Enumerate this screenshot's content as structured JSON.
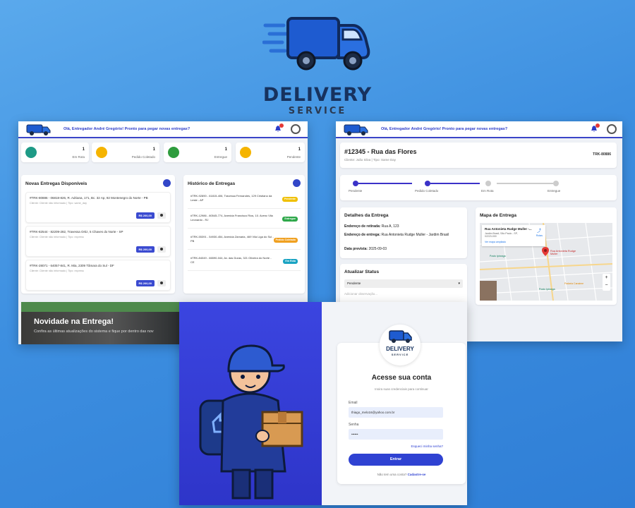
{
  "brand": {
    "title": "DELIVERY",
    "subtitle": "SERVICE"
  },
  "dashboard": {
    "greeting": "Olá, Entregador André Gregório! Pronto para pegar novas entregas?",
    "stats": [
      {
        "icon": "route-icon",
        "value": "1",
        "label": "Em Rota",
        "color": "#1e9a86"
      },
      {
        "icon": "clock-icon",
        "value": "1",
        "label": "Pedido Coletado",
        "color": "#f5b400"
      },
      {
        "icon": "thumbs-up-icon",
        "value": "1",
        "label": "Entregue",
        "color": "#2e9c3e"
      },
      {
        "icon": "clock-icon",
        "value": "1",
        "label": "Pendente",
        "color": "#f5b400"
      }
    ],
    "new_title": "Novas Entregas Disponíveis",
    "new_deliveries": [
      {
        "title": "#TRK-80886 - 06818-826, R. Adriana, 171, Bc. 32 Ap, 92 Montenegro do Norte - PB",
        "meta": "Cliente: Cliente não informado | Tipo: same_day",
        "price": "R$ 200,00"
      },
      {
        "title": "#TRK-82544 - 82209-282, Travessa Ortiz, 5 Chaves do Norte - SP",
        "meta": "Cliente: Cliente não informado | Tipo: express",
        "price": "R$ 200,00"
      },
      {
        "title": "#TRK-28071 - 64057-841, R. Mia, 2309 Tâmara do Sul - DF",
        "meta": "Cliente: Cliente não informado | Tipo: express",
        "price": "R$ 200,00"
      }
    ],
    "history_title": "Histórico de Entregas",
    "history": [
      {
        "text": "#TRK-92890 - 61815-406, Travessa Fernandes, 129 Cristiano da Leste - AP",
        "status": "Pendente",
        "color": "#f0c000"
      },
      {
        "text": "#TRK-12986 - 80545-774, Avenida Francisco Rios, 10. Avenc Vila Leonardo - RJ",
        "status": "Entregue",
        "color": "#2ea84a"
      },
      {
        "text": "#TRK-55391 - 54930-454, Avenida Zamaria, 469 Vila Liga do Sul - PB",
        "status": "Pedido Coletado",
        "color": "#f0a020"
      },
      {
        "text": "#TRK-84049 - 66590-044, Av. das Duras, 321 Oliveira do Norte - CE",
        "status": "Em Rota",
        "color": "#1aa3c2"
      }
    ],
    "news_title": "Novidade na Entrega!",
    "news_sub": "Confira as últimas atualizações do sistema e fique por dentro das nov"
  },
  "details": {
    "greeting": "Olá, Entregador André Gregório! Pronto para pegar novas entregas?",
    "title": "#12345 - Rua das Flores",
    "client": "Cliente: João Silva | Tipo: Same Day",
    "tracking": "TRK-80886",
    "steps": [
      "Pendente",
      "Pedido Coletado",
      "Em Rota",
      "Entregue"
    ],
    "details_title": "Detalhes da Entrega",
    "pickup_label": "Endereço de retirada:",
    "pickup": "Rua A, 123",
    "delivery_label": "Endereço de entrega:",
    "delivery": "Rua Antonieta Rudge Muller - Jardim Brasil",
    "date_label": "Data prevista:",
    "date": "2025-09-03",
    "map_title": "Mapa de Entrega",
    "map_place": "Rua Antonieta Rudge Muller -...",
    "map_place_sub": "Jardim Brasil, São Paulo - SP, 02223-000",
    "map_route": "Rotas",
    "map_enlarge": "Ver mapa ampliado",
    "map_pin_label": "Rua Antonieta Rudge Muller",
    "map_poi1": "Posto Ipiranga",
    "map_poi2": "Padaria Canaime",
    "map_poi3": "Posto Ipiranga",
    "update_title": "Atualizar Status",
    "update_select": "Pendente",
    "update_placeholder": "Adicionar observação..."
  },
  "login": {
    "title": "Acesse sua conta",
    "subtitle": "Insira suas credenciais para continuar",
    "email_label": "Email",
    "email_value": "thiago_melo16@yahoo.com.br",
    "password_label": "Senha",
    "password_value": "••••••",
    "forgot": "Esqueci minha senha?",
    "button": "Entrar",
    "no_account": "Não tem uma conta?",
    "signup": "Cadastre-se"
  }
}
